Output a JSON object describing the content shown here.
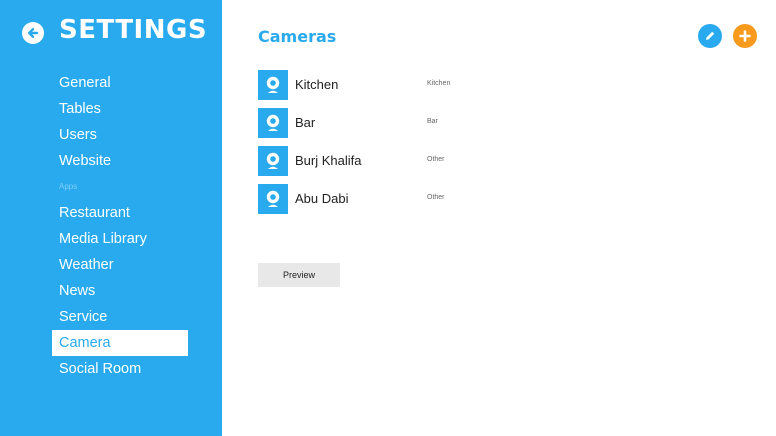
{
  "sidebar": {
    "title": "SETTINGS",
    "items": [
      {
        "label": "General"
      },
      {
        "label": "Tables"
      },
      {
        "label": "Users"
      },
      {
        "label": "Website"
      }
    ],
    "section_label": "Apps",
    "app_items": [
      {
        "label": "Restaurant"
      },
      {
        "label": "Media Library"
      },
      {
        "label": "Weather"
      },
      {
        "label": "News"
      },
      {
        "label": "Service"
      },
      {
        "label": "Camera",
        "active": true
      },
      {
        "label": "Social Room"
      }
    ]
  },
  "main": {
    "title": "Cameras",
    "cameras": [
      {
        "name": "Kitchen",
        "type": "Kitchen"
      },
      {
        "name": "Bar",
        "type": "Bar"
      },
      {
        "name": "Burj Khalifa",
        "type": "Other"
      },
      {
        "name": "Abu Dabi",
        "type": "Other"
      }
    ],
    "preview_label": "Preview"
  },
  "icons": {
    "back": "arrow-left-icon",
    "edit": "pencil-icon",
    "add": "plus-icon",
    "camera": "webcam-icon"
  },
  "colors": {
    "sidebar_bg": "#29aaee",
    "accent": "#29aaee",
    "add_button": "#f89a1c",
    "preview_bg": "#e8e8e8"
  }
}
